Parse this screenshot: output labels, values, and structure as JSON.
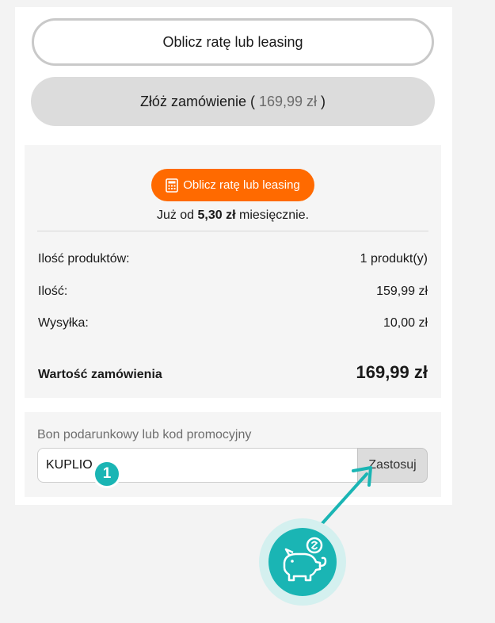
{
  "buttons": {
    "calc_outline": "Oblicz ratę lub leasing",
    "order_prefix": "Złóż zamówienie ( ",
    "order_price": "169,99 zł",
    "order_suffix": " )",
    "calc_orange": "Oblicz ratę lub leasing"
  },
  "installment": {
    "prefix": "Już od ",
    "amount": "5,30 zł",
    "suffix": " miesięcznie."
  },
  "summary": {
    "rows": [
      {
        "label": "Ilość produktów:",
        "value": "1 produkt(y)"
      },
      {
        "label": "Ilość:",
        "value": "159,99 zł"
      },
      {
        "label": "Wysyłka:",
        "value": "10,00 zł"
      }
    ],
    "total_label": "Wartość zamówienia",
    "total_value": "169,99 zł"
  },
  "promo": {
    "label": "Bon podarunkowy lub kod promocyjny",
    "input_value": "KUPLIO",
    "apply_label": "Zastosuj"
  },
  "annotation": {
    "step_number": "1",
    "accent_color": "#1ab5b4",
    "icon": "piggy-bank-coin-icon"
  },
  "colors": {
    "orange": "#ff6a00"
  }
}
